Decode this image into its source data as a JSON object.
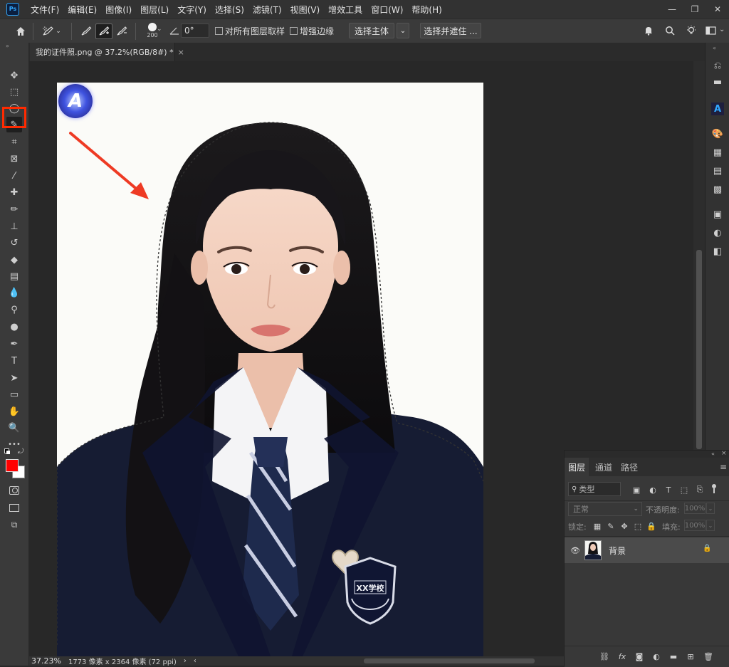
{
  "app": {
    "logo": "Ps"
  },
  "menu": [
    "文件(F)",
    "编辑(E)",
    "图像(I)",
    "图层(L)",
    "文字(Y)",
    "选择(S)",
    "滤镜(T)",
    "视图(V)",
    "增效工具",
    "窗口(W)",
    "帮助(H)"
  ],
  "window_controls": {
    "minimize": "—",
    "restore": "❐",
    "close": "✕"
  },
  "options": {
    "brush_size": "200",
    "angle_value": "0°",
    "sample_all_layers_label": "对所有图层取样",
    "sample_all_layers_checked": false,
    "enhance_edge_label": "增强边缘",
    "enhance_edge_checked": false,
    "select_subject_label": "选择主体",
    "select_and_mask_label": "选择并遮住 ..."
  },
  "document": {
    "tab_title": "我的证件照.png @ 37.2%(RGB/8#) *",
    "close_glyph": "×",
    "badge_letter": "A",
    "school_crest_text": "XX学校"
  },
  "tools": [
    {
      "name": "move-tool",
      "icon": "✥",
      "selected": false
    },
    {
      "name": "marquee-tool",
      "icon": "⬚",
      "selected": false
    },
    {
      "name": "lasso-tool",
      "icon": "◯",
      "selected": false
    },
    {
      "name": "quick-selection-tool",
      "icon": "✎",
      "selected": true
    },
    {
      "name": "crop-tool",
      "icon": "⌗",
      "selected": false
    },
    {
      "name": "frame-tool",
      "icon": "⊠",
      "selected": false
    },
    {
      "name": "eyedropper-tool",
      "icon": "⁄",
      "selected": false
    },
    {
      "name": "healing-brush-tool",
      "icon": "✚",
      "selected": false
    },
    {
      "name": "brush-tool",
      "icon": "✏",
      "selected": false
    },
    {
      "name": "clone-stamp-tool",
      "icon": "⊥",
      "selected": false
    },
    {
      "name": "history-brush-tool",
      "icon": "↺",
      "selected": false
    },
    {
      "name": "eraser-tool",
      "icon": "◆",
      "selected": false
    },
    {
      "name": "gradient-tool",
      "icon": "▤",
      "selected": false
    },
    {
      "name": "blur-tool",
      "icon": "💧",
      "selected": false
    },
    {
      "name": "dodge-tool",
      "icon": "⚲",
      "selected": false
    },
    {
      "name": "sponge-tool",
      "icon": "●",
      "selected": false
    },
    {
      "name": "pen-tool",
      "icon": "✒",
      "selected": false
    },
    {
      "name": "type-tool",
      "icon": "T",
      "selected": false
    },
    {
      "name": "path-selection-tool",
      "icon": "➤",
      "selected": false
    },
    {
      "name": "rectangle-tool",
      "icon": "▭",
      "selected": false
    },
    {
      "name": "hand-tool",
      "icon": "✋",
      "selected": false
    },
    {
      "name": "zoom-tool",
      "icon": "🔍",
      "selected": false
    },
    {
      "name": "edit-toolbar",
      "icon": "•••",
      "selected": false
    }
  ],
  "colors": {
    "foreground": "#ff0000",
    "background": "#ffffff",
    "highlight": "#ff2a00",
    "accent": "#31a8ff",
    "arrow": "#ee3a24"
  },
  "right_dock_icons": [
    "history-icon",
    "comments-icon",
    "adobe-express-icon",
    "color-icon",
    "swatches-icon",
    "gradients-icon",
    "patterns-icon",
    "libraries-icon",
    "adjustments-icon",
    "properties-icon"
  ],
  "layers_panel": {
    "tabs": [
      "图层",
      "通道",
      "路径"
    ],
    "active_tab": "图层",
    "filter_label": "类型",
    "blend_mode": "正常",
    "opacity_label": "不透明度:",
    "opacity_value": "100%",
    "lock_label": "锁定:",
    "fill_label": "填充:",
    "fill_value": "100%",
    "layers": [
      {
        "name": "背景",
        "visible": true,
        "locked": true
      }
    ],
    "footer_icons": [
      "link-icon",
      "fx-icon",
      "mask-icon",
      "adjustment-layer-icon",
      "folder-icon",
      "new-layer-icon",
      "trash-icon"
    ]
  },
  "status": {
    "zoom": "37.23%",
    "doc_info": "1773 像素 x 2364 像素 (72 ppi)"
  }
}
